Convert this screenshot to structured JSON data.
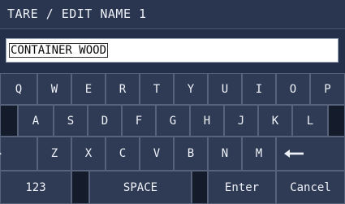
{
  "title": "TARE / EDIT NAME 1",
  "input": {
    "value": "CONTAINER WOOD"
  },
  "keyboard": {
    "row1": [
      "Q",
      "W",
      "E",
      "R",
      "T",
      "Y",
      "U",
      "I",
      "O",
      "P"
    ],
    "row2": [
      "A",
      "S",
      "D",
      "F",
      "G",
      "H",
      "J",
      "K",
      "L"
    ],
    "row3": [
      "Z",
      "X",
      "C",
      "V",
      "B",
      "N",
      "M"
    ],
    "shift_icon": "shift-up-arrow-icon",
    "backspace_icon": "left-arrow-icon",
    "numbers_label": "123",
    "space_label": "SPACE",
    "enter_label": "Enter",
    "cancel_label": "Cancel"
  },
  "colors": {
    "background": "#24304a",
    "key": "#2f3b55",
    "key_border": "#56617a",
    "text": "#eef1f7"
  }
}
